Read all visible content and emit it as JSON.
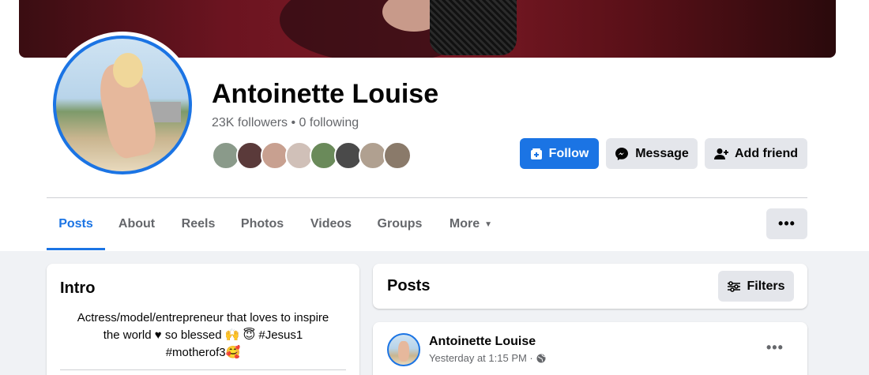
{
  "profile": {
    "name": "Antoinette Louise",
    "stats": "23K followers • 0 following"
  },
  "friends": [
    {
      "color": "#8a9a8a"
    },
    {
      "color": "#5a3a3a"
    },
    {
      "color": "#c8a090"
    },
    {
      "color": "#d0c0b8"
    },
    {
      "color": "#6a8a5a"
    },
    {
      "color": "#4a4a4a"
    },
    {
      "color": "#b0a090"
    },
    {
      "color": "#8a7a6a"
    },
    {
      "color": "#5a5a4a"
    }
  ],
  "actions": {
    "follow": "Follow",
    "message": "Message",
    "add_friend": "Add friend"
  },
  "tabs": [
    {
      "label": "Posts",
      "active": true
    },
    {
      "label": "About"
    },
    {
      "label": "Reels"
    },
    {
      "label": "Photos"
    },
    {
      "label": "Videos"
    },
    {
      "label": "Groups"
    },
    {
      "label": "More"
    }
  ],
  "more_button": "•••",
  "intro": {
    "title": "Intro",
    "bio_line1": "Actress/model/entrepreneur that loves to inspire",
    "bio_line2": "the world ♥ so blessed 🙌 😇 #Jesus1",
    "bio_line3": "#motherof3🥰"
  },
  "posts": {
    "title": "Posts",
    "filters": "Filters"
  },
  "post": {
    "author": "Antoinette Louise",
    "time": "Yesterday at 1:15 PM ·",
    "menu": "•••"
  },
  "colors": {
    "accent": "#1b74e4",
    "secondary_button": "#e4e6eb",
    "muted_text": "#65676b",
    "background": "#f0f2f5"
  }
}
